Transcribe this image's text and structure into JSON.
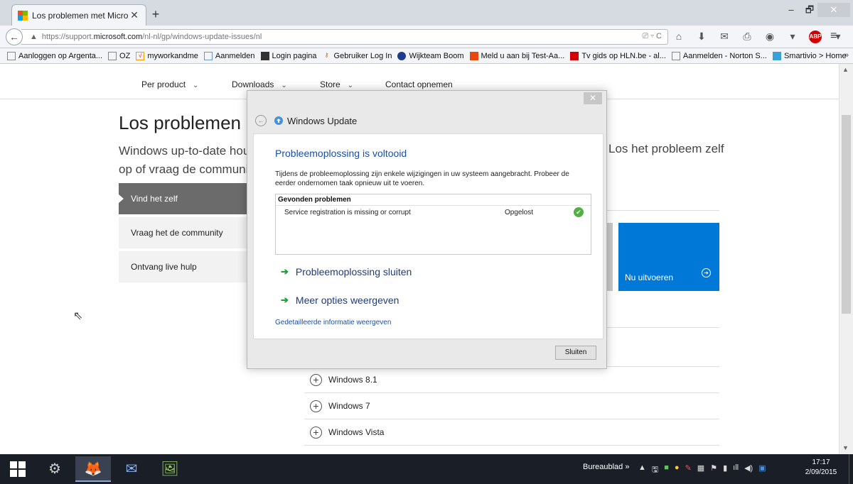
{
  "browser": {
    "tab_title": "Los problemen met Micro...",
    "tab_close": "✕",
    "new_tab": "+",
    "window_controls": {
      "minimize": "–",
      "restore": "🗗",
      "close": "✕"
    },
    "back": "←",
    "url_prefix": "https://support.",
    "url_domain": "microsoft.com",
    "url_suffix": "/nl-nl/gp/windows-update-issues/nl",
    "url_tools": "⎚ ▿ C",
    "toolbar_icons": [
      "⌂",
      "⬇",
      "✉",
      "⎙",
      "◉",
      "▾",
      "ABP",
      "▾"
    ],
    "menu": "≡",
    "bookmarks": [
      {
        "label": "Aanloggen op Argenta...",
        "icon": ""
      },
      {
        "label": "OZ",
        "icon": ""
      },
      {
        "label": "myworkandme",
        "icon": ""
      },
      {
        "label": "Aanmelden",
        "icon": ""
      },
      {
        "label": "Login pagina",
        "icon": ""
      },
      {
        "label": "Gebruiker Log In",
        "icon": ""
      },
      {
        "label": "Wijkteam Boom",
        "icon": ""
      },
      {
        "label": "Meld u aan bij Test-Aa...",
        "icon": ""
      },
      {
        "label": "Tv gids op HLN.be - al...",
        "icon": ""
      },
      {
        "label": "Aanmelden - Norton S...",
        "icon": ""
      },
      {
        "label": "Smartivio > Home",
        "icon": ""
      }
    ],
    "bookmarks_more": "»"
  },
  "site": {
    "nav": [
      {
        "label": "Per product"
      },
      {
        "label": "Downloads"
      },
      {
        "label": "Store"
      },
      {
        "label": "Contact opnemen"
      }
    ],
    "chevron": "⌄",
    "title": "Los problemen m",
    "intro_line1": "Windows up-to-date hou",
    "intro_line2": "op of vraag de communi",
    "intro_right": "Los het probleem zelf",
    "left_nav": [
      {
        "label": "Vind het zelf"
      },
      {
        "label": "Vraag het de community"
      },
      {
        "label": "Ontvang live hulp"
      }
    ],
    "tile_label": "Nu uitvoeren",
    "tile_icon": "⊙",
    "versions": [
      "Windows 8.1",
      "Windows 7",
      "Windows Vista"
    ],
    "plus_icon": "+"
  },
  "dialog": {
    "close": "✕",
    "back": "←",
    "title": "Windows Update",
    "heading": "Probleemoplossing is voltooid",
    "description": "Tijdens de probleemoplossing zijn enkele wijzigingen in uw systeem aangebracht. Probeer de eerder ondernomen taak opnieuw uit te voeren.",
    "found_header": "Gevonden problemen",
    "problems": [
      {
        "name": "Service registration is missing or corrupt",
        "status": "Opgelost",
        "icon": "✔"
      }
    ],
    "action_arrow": "➔",
    "actions": [
      "Probleemoplossing sluiten",
      "Meer opties weergeven"
    ],
    "details_link": "Gedetailleerde informatie weergeven",
    "button": "Sluiten"
  },
  "taskbar": {
    "apps": [
      "⚙",
      "🦊",
      "✉",
      "🖼"
    ],
    "desktop_label": "Bureaublad",
    "tray_expand": "»",
    "tray_icons": [
      "▲",
      "🖫",
      "■",
      "●",
      "✎",
      "▦",
      "⚑",
      "▮",
      "ıll",
      "◀)",
      "▣"
    ],
    "time": "17:17",
    "date": "2/09/2015"
  },
  "colors": {
    "accent": "#0078d7",
    "link": "#1a4fa8",
    "action_arrow": "#21a03a",
    "ok_green": "#52b043"
  }
}
